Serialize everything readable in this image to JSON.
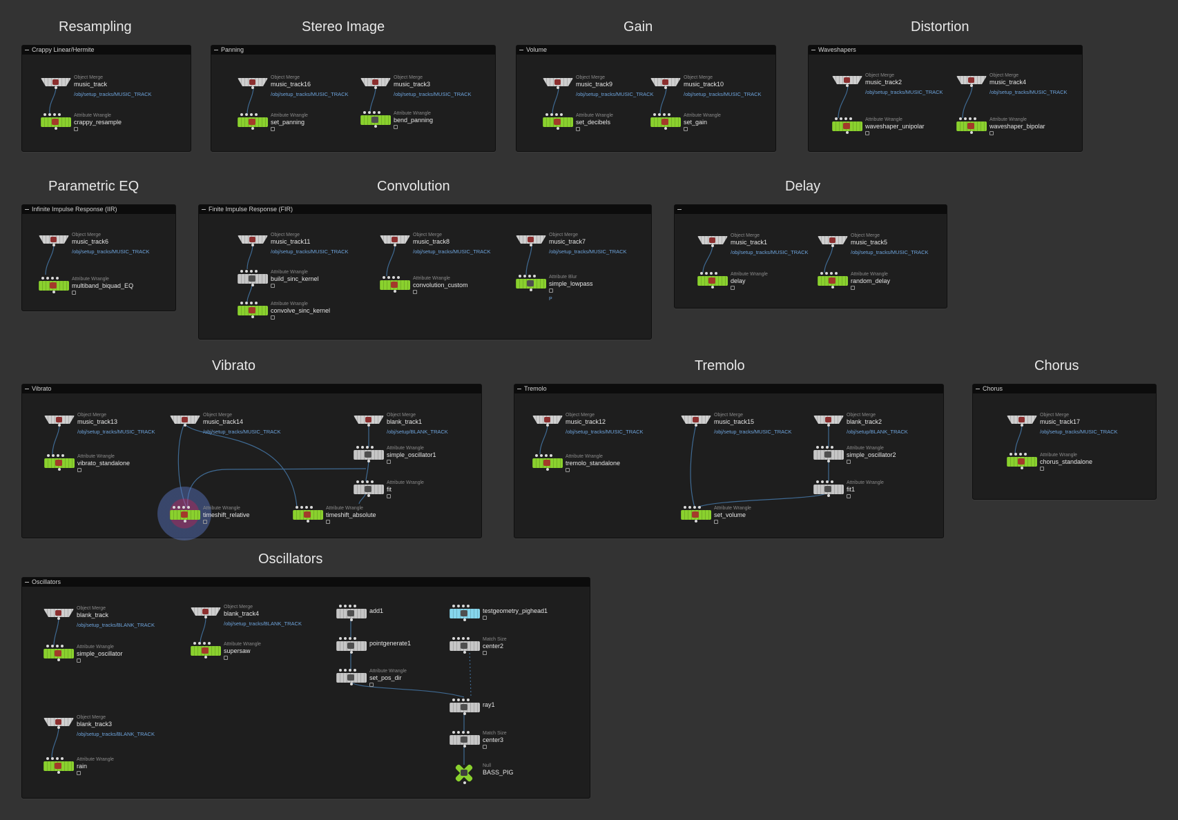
{
  "section_titles": {
    "resampling": "Resampling",
    "stereo_image": "Stereo Image",
    "gain": "Gain",
    "distortion": "Distortion",
    "parametric_eq": "Parametric EQ",
    "convolution": "Convolution",
    "delay": "Delay",
    "vibrato": "Vibrato",
    "tremolo": "Tremolo",
    "chorus": "Chorus",
    "oscillators": "Oscillators"
  },
  "netboxes": {
    "resampling": "Crappy Linear/Hermite",
    "stereo_image": "Panning",
    "gain": "Volume",
    "distortion": "Waveshapers",
    "parametric_eq": "Infinite Impulse Response (IIR)",
    "convolution": "Finite Impulse Response (FIR)",
    "delay": "",
    "vibrato": "Vibrato",
    "tremolo": "Tremolo",
    "chorus": "Chorus",
    "oscillators": "Oscillators"
  },
  "node_types": {
    "object_merge": "Object Merge",
    "attribute_wrangle": "Attribute Wrangle",
    "attribute_blur": "Attribute Blur",
    "match_size": "Match Size",
    "null": "Null"
  },
  "paths": {
    "music": "/obj/setup_tracks/MUSIC_TRACK",
    "blank": "/obj/setup/BLANK_TRACK",
    "blank_tracks": "/obj/setup_tracks/BLANK_TRACK"
  },
  "nodes": {
    "music_track": "music_track",
    "crappy_resample": "crappy_resample",
    "music_track16": "music_track16",
    "set_panning": "set_panning",
    "music_track3": "music_track3",
    "bend_panning": "bend_panning",
    "music_track9": "music_track9",
    "set_decibels": "set_decibels",
    "music_track10": "music_track10",
    "set_gain": "set_gain",
    "music_track2": "music_track2",
    "waveshaper_unipolar": "waveshaper_unipolar",
    "music_track4": "music_track4",
    "waveshaper_bipolar": "waveshaper_bipolar",
    "music_track6": "music_track6",
    "multiband_biquad_EQ": "multiband_biquad_EQ",
    "music_track11": "music_track11",
    "build_sinc_kernel": "build_sinc_kernel",
    "convolve_sinc_kernel": "convolve_sinc_kernel",
    "music_track8": "music_track8",
    "convolution_custom": "convolution_custom",
    "music_track7": "music_track7",
    "simple_lowpass": "simple_lowpass",
    "lowpass_flag": "P",
    "music_track1": "music_track1",
    "delay": "delay",
    "music_track5": "music_track5",
    "random_delay": "random_delay",
    "music_track13": "music_track13",
    "vibrato_standalone": "vibrato_standalone",
    "music_track14": "music_track14",
    "blank_track1": "blank_track1",
    "simple_oscillator1": "simple_oscillator1",
    "fit": "fit",
    "timeshift_relative": "timeshift_relative",
    "timeshift_absolute": "timeshift_absolute",
    "music_track12": "music_track12",
    "tremolo_standalone": "tremolo_standalone",
    "music_track15": "music_track15",
    "blank_track2": "blank_track2",
    "simple_oscillator2": "simple_oscillator2",
    "fit1": "fit1",
    "set_volume": "set_volume",
    "music_track17": "music_track17",
    "chorus_standalone": "chorus_standalone",
    "blank_track": "blank_track",
    "simple_oscillator": "simple_oscillator",
    "blank_track4": "blank_track4",
    "supersaw": "supersaw",
    "add1": "add1",
    "pointgenerate1": "pointgenerate1",
    "set_pos_dir": "set_pos_dir",
    "testgeometry_pighead1": "testgeometry_pighead1",
    "center2": "center2",
    "ray1": "ray1",
    "center3": "center3",
    "BASS_PIG": "BASS_PIG",
    "blank_track3": "blank_track3",
    "rain": "rain"
  },
  "colors": {
    "background": "#333333",
    "netbox": "#1e1e1e",
    "wrangle_node": "#8ad12e",
    "merge_node": "#cfcfcf",
    "geometry_node": "#86d6ec",
    "path_text": "#6ea4dc",
    "wire": "#3f6a93"
  },
  "icons": {
    "node_flag": "lock-icon",
    "netbox_collapse": "collapse-dash-icon"
  }
}
